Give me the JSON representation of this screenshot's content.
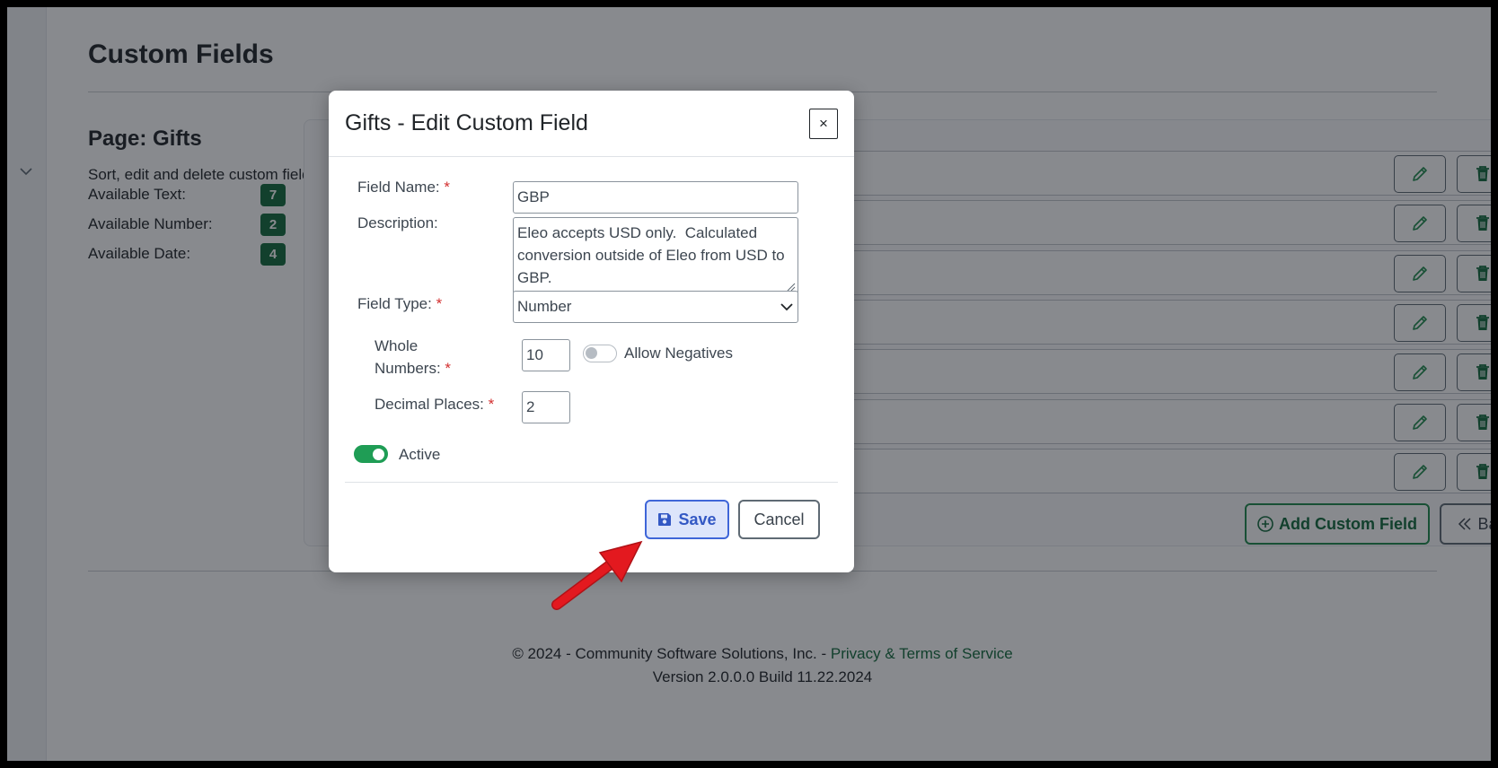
{
  "page": {
    "title": "Custom Fields",
    "section_title": "Page: Gifts",
    "section_description": "Sort, edit and delete custom field defi",
    "available": [
      {
        "label": "Available Text:",
        "count": "7"
      },
      {
        "label": "Available Number:",
        "count": "2"
      },
      {
        "label": "Available Date:",
        "count": "4"
      }
    ],
    "add_button": "Add Custom Field",
    "back_button": "Back to Settings"
  },
  "footer": {
    "copyright": "© 2024 - Community Software Solutions, Inc. - ",
    "privacy_link": "Privacy & Terms of Service",
    "version": "Version 2.0.0.0 Build 11.22.2024"
  },
  "modal": {
    "title": "Gifts - Edit Custom Field",
    "close": "×",
    "field_name_label": "Field Name:",
    "field_name_value": "GBP",
    "description_label": "Description:",
    "description_value": "Eleo accepts USD only.  Calculated conversion outside of Eleo from USD to GBP.",
    "field_type_label": "Field Type:",
    "field_type_value": "Number",
    "whole_numbers_label_line1": "Whole",
    "whole_numbers_label_line2": "Numbers:",
    "whole_numbers_value": "10",
    "allow_negatives_label": "Allow Negatives",
    "allow_negatives_on": false,
    "decimal_places_label": "Decimal Places:",
    "decimal_places_value": "2",
    "active_label": "Active",
    "active_on": true,
    "required_marker": "*",
    "save_label": "Save",
    "cancel_label": "Cancel"
  },
  "colors": {
    "primary_green": "#126b3c",
    "save_blue": "#3f66d8",
    "required_red": "#d32f2f",
    "annotation_arrow": "#e3191f"
  }
}
